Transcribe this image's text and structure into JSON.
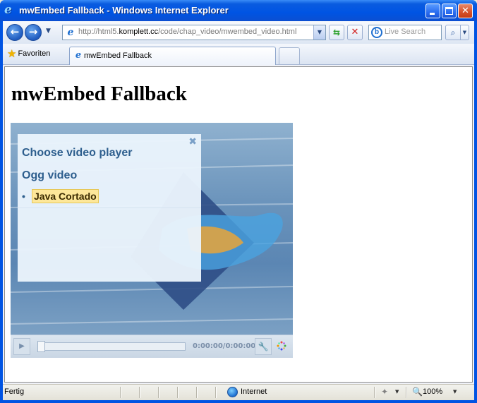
{
  "window": {
    "title": "mwEmbed Fallback - Windows Internet Explorer"
  },
  "navbar": {
    "address_prefix": "http://html5.",
    "address_domain": "komplett.cc",
    "address_path": "/code/chap_video/mwembed_video.html",
    "search_placeholder": "Live Search",
    "search_logo_letter": "b"
  },
  "tabbar": {
    "favorites_label": "Favoriten",
    "tab_label": "mwEmbed Fallback"
  },
  "page": {
    "heading": "mwEmbed Fallback",
    "player": {
      "chooser": {
        "heading": "Choose video player",
        "format_heading": "Ogg video",
        "options": [
          "Java Cortado"
        ]
      },
      "time_display": "0:00:00/0:00:00",
      "progress": 0
    }
  },
  "statusbar": {
    "status": "Fertig",
    "zone": "Internet",
    "zoom": "100%"
  },
  "colors": {
    "titlebar": "#0054e3",
    "chooser_text": "#2e5f8e",
    "highlight": "#fde79a"
  },
  "icons": [
    "ie-icon",
    "back-arrow-icon",
    "forward-arrow-icon",
    "refresh-icon",
    "stop-icon",
    "search-icon",
    "star-icon",
    "globe-icon",
    "zoom-icon",
    "close-icon",
    "play-icon",
    "wrench-icon"
  ]
}
